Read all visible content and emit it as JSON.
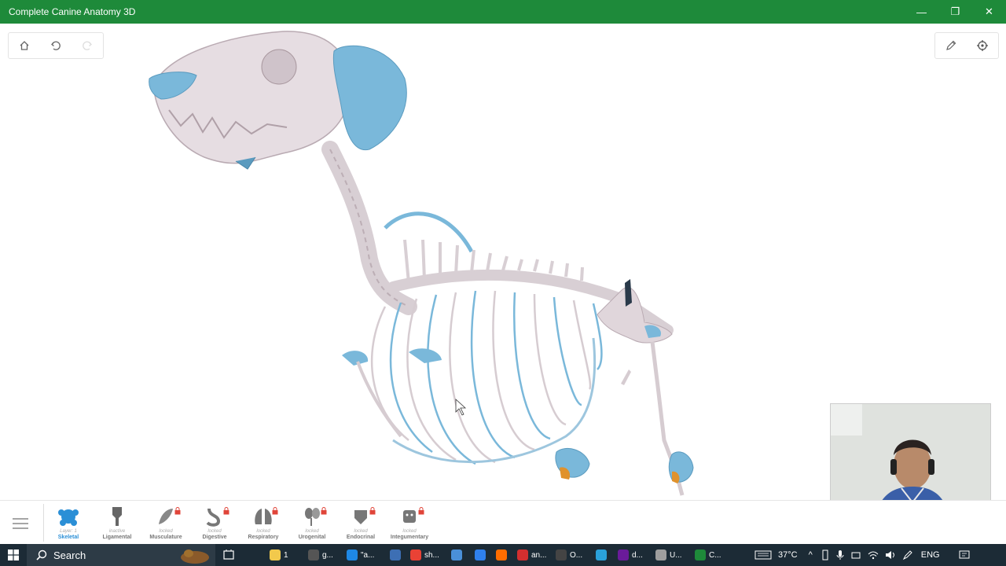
{
  "window": {
    "title": "Complete Canine Anatomy 3D",
    "minimize": "—",
    "restore": "❐",
    "close": "✕"
  },
  "colors": {
    "titlebar": "#1e8a3a",
    "bone": "#e8e0e4",
    "highlight": "#7ab8da",
    "active": "#2b8fd6",
    "taskbar": "#1c2b36"
  },
  "tools": {
    "home": "home-icon",
    "undo": "undo-icon",
    "redo": "redo-icon",
    "pen": "pen-icon",
    "target": "crosshair-icon"
  },
  "layers": [
    {
      "state": "Layer: 1",
      "name": "Skeletal",
      "active": true,
      "locked": false
    },
    {
      "state": "inactive",
      "name": "Ligamental",
      "active": false,
      "locked": false
    },
    {
      "state": "locked",
      "name": "Musculature",
      "active": false,
      "locked": true
    },
    {
      "state": "locked",
      "name": "Digestive",
      "active": false,
      "locked": true
    },
    {
      "state": "locked",
      "name": "Respiratory",
      "active": false,
      "locked": true
    },
    {
      "state": "locked",
      "name": "Urogenital",
      "active": false,
      "locked": true
    },
    {
      "state": "locked",
      "name": "Endocrinal",
      "active": false,
      "locked": true
    },
    {
      "state": "locked",
      "name": "Integumentary",
      "active": false,
      "locked": true
    }
  ],
  "taskbar": {
    "search_label": "Search",
    "apps": [
      {
        "label": "1",
        "color": "#f2c94c"
      },
      {
        "label": "g...",
        "color": "#555"
      },
      {
        "label": "\"a...",
        "color": "#1e88e5"
      },
      {
        "label": "",
        "color": "#3d6fb4"
      },
      {
        "label": "sh...",
        "color": "#e94235"
      },
      {
        "label": "",
        "color": "#4a90d9"
      },
      {
        "label": "",
        "color": "#2f80ed"
      },
      {
        "label": "",
        "color": "#ff6d00"
      },
      {
        "label": "an...",
        "color": "#d32f2f"
      },
      {
        "label": "O...",
        "color": "#444"
      },
      {
        "label": "",
        "color": "#2aa1da"
      },
      {
        "label": "d...",
        "color": "#6a1b9a"
      },
      {
        "label": "U...",
        "color": "#9e9e9e"
      },
      {
        "label": "C...",
        "color": "#1e8a3a"
      }
    ],
    "temperature": "37°C",
    "language": "ENG"
  }
}
